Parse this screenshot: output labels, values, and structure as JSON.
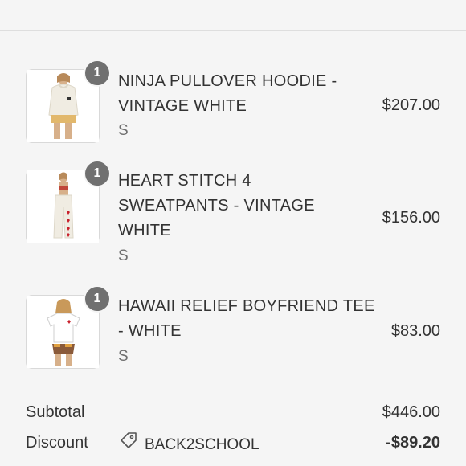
{
  "items": [
    {
      "name_line1": "NINJA PULLOVER HOODIE -",
      "name_line2": "VINTAGE WHITE",
      "name_line3": "",
      "variant": "S",
      "price": "$207.00",
      "quantity": "1"
    },
    {
      "name_line1": "HEART STITCH 4",
      "name_line2": "SWEATPANTS - VINTAGE",
      "name_line3": "WHITE",
      "variant": "S",
      "price": "$156.00",
      "quantity": "1"
    },
    {
      "name_line1": "HAWAII RELIEF BOYFRIEND TEE",
      "name_line2": "- WHITE",
      "name_line3": "",
      "variant": "S",
      "price": "$83.00",
      "quantity": "1"
    }
  ],
  "summary": {
    "subtotal_label": "Subtotal",
    "subtotal_value": "$446.00",
    "discount_label": "Discount",
    "discount_code": "BACK2SCHOOL",
    "discount_value": "-$89.20"
  },
  "icons": {
    "discount": "tag-icon"
  }
}
